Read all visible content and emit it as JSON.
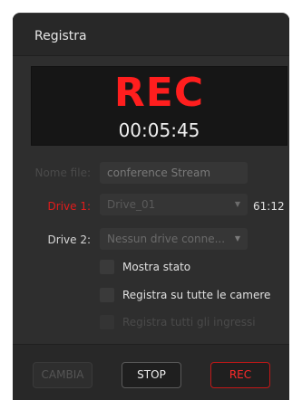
{
  "panel": {
    "title": "Registra"
  },
  "display": {
    "status": "REC",
    "timecode": "00:05:45"
  },
  "filename": {
    "label": "Nome file:",
    "value": "conference Stream"
  },
  "drive1": {
    "label": "Drive 1:",
    "value": "Drive_01",
    "remaining": "61:12"
  },
  "drive2": {
    "label": "Drive 2:",
    "value": "Nessun drive conne..."
  },
  "options": [
    {
      "label": "Mostra stato",
      "enabled": true
    },
    {
      "label": "Registra su tutte le camere",
      "enabled": true
    },
    {
      "label": "Registra tutti gli ingressi",
      "enabled": false
    }
  ],
  "buttons": {
    "change": "CAMBIA",
    "stop": "STOP",
    "rec": "REC"
  },
  "colors": {
    "rec_red": "#ff1e1e",
    "panel_bg": "#2e2e2e",
    "display_bg": "#161616"
  },
  "icons": {
    "dropdown": "chevron-down-icon"
  }
}
